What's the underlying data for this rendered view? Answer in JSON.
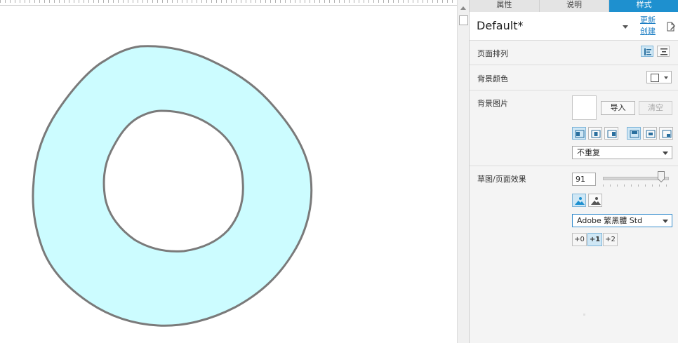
{
  "tabs": [
    {
      "label": "属性",
      "active": false
    },
    {
      "label": "说明",
      "active": false
    },
    {
      "label": "样式",
      "active": true
    }
  ],
  "style_selector": {
    "value": "Default*",
    "update_link": "更新",
    "create_link": "创建"
  },
  "page_align": {
    "label": "页面排列",
    "options": [
      "align-left-icon",
      "align-center-icon"
    ],
    "selected": 0
  },
  "background_color": {
    "label": "背景颜色",
    "value": "#ffffff"
  },
  "background_image": {
    "label": "背景图片",
    "import_button": "导入",
    "clear_button": "清空",
    "repeat_select": "不重复"
  },
  "sketch": {
    "label": "草图/页面效果",
    "sketchiness_value": "91",
    "sketchiness_fraction": 0.9,
    "color_modes": [
      "color-image-icon",
      "grayscale-image-icon"
    ],
    "font_select": "Adobe 繁黑體 Std",
    "line_offsets": [
      "+0",
      "+1",
      "+2"
    ],
    "selected_offset": 1
  },
  "colors": {
    "accent": "#1e90cf",
    "shape_fill": "#ccfcff",
    "shape_stroke": "#7a7a7a"
  }
}
